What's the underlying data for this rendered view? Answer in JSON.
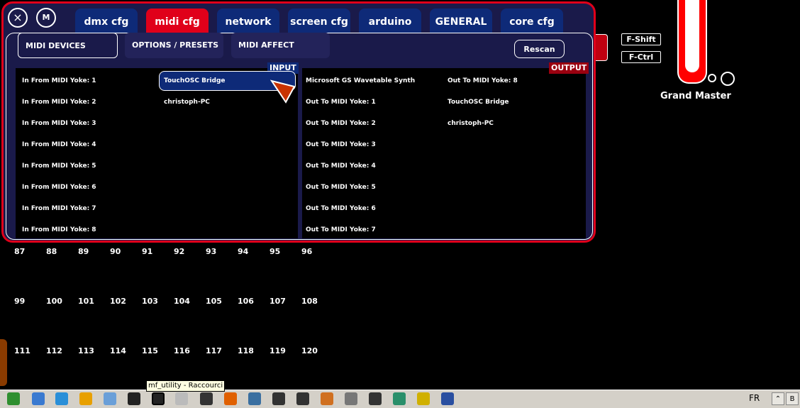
{
  "tabs": [
    {
      "label": "dmx cfg",
      "active": false
    },
    {
      "label": "midi cfg",
      "active": true
    },
    {
      "label": "network cfg",
      "active": false
    },
    {
      "label": "screen cfg",
      "active": false
    },
    {
      "label": "arduino cfg",
      "active": false
    },
    {
      "label": "GENERAL",
      "active": false
    },
    {
      "label": "core cfg",
      "active": false
    }
  ],
  "controls": {
    "close_icon": "×",
    "m_label": "M"
  },
  "subtabs": [
    {
      "label": "MIDI DEVICES",
      "selected": true
    },
    {
      "label": "OPTIONS / PRESETS",
      "selected": false
    },
    {
      "label": "MIDI AFFECT",
      "selected": false
    }
  ],
  "rescan_label": "Rescan",
  "input": {
    "badge": "INPUT",
    "col1": [
      "In From MIDI Yoke:  1",
      "In From MIDI Yoke:  2",
      "In From MIDI Yoke:  3",
      "In From MIDI Yoke:  4",
      "In From MIDI Yoke:  5",
      "In From MIDI Yoke:  6",
      "In From MIDI Yoke:  7",
      "In From MIDI Yoke:  8"
    ],
    "col2": [
      "TouchOSC Bridge",
      "christoph-PC"
    ],
    "selected": "TouchOSC Bridge"
  },
  "output": {
    "badge": "OUTPUT",
    "col1": [
      "Microsoft GS Wavetable Synth",
      "Out To MIDI Yoke:  1",
      "Out To MIDI Yoke:  2",
      "Out To MIDI Yoke:  3",
      "Out To MIDI Yoke:  4",
      "Out To MIDI Yoke:  5",
      "Out To MIDI Yoke:  6",
      "Out To MIDI Yoke:  7"
    ],
    "col2": [
      "Out To MIDI Yoke:  8",
      "TouchOSC Bridge",
      "christoph-PC"
    ]
  },
  "fkeys": [
    "F-Shift",
    "F-Ctrl"
  ],
  "grand_master": {
    "label": "Grand Master"
  },
  "grid_rows": [
    [
      "87",
      "88",
      "89",
      "90",
      "91",
      "92",
      "93",
      "94",
      "95",
      "96"
    ],
    [
      "99",
      "100",
      "101",
      "102",
      "103",
      "104",
      "105",
      "106",
      "107",
      "108"
    ],
    [
      "111",
      "112",
      "113",
      "114",
      "115",
      "116",
      "117",
      "118",
      "119",
      "120"
    ]
  ],
  "taskbar": {
    "tooltip": "mf_utility - Raccourci",
    "language": "FR",
    "tray": [
      "⌃",
      "B"
    ],
    "icons": [
      "chrome-icon",
      "globe-icon",
      "refresh-icon",
      "windows-icon",
      "app-icon",
      "paw-icon",
      "paw-icon",
      "lock-icon",
      "game-icon",
      "brush-icon",
      "dial-icon",
      "osc-icon",
      "b-icon",
      "settings-icon",
      "square-icon",
      "terminal-icon",
      "tool-icon",
      "disc-icon",
      "hp-icon"
    ]
  },
  "colors": {
    "accent": "#e0001a",
    "tab_blue": "#0e2a78",
    "panel_bg": "#1a1a4a"
  }
}
